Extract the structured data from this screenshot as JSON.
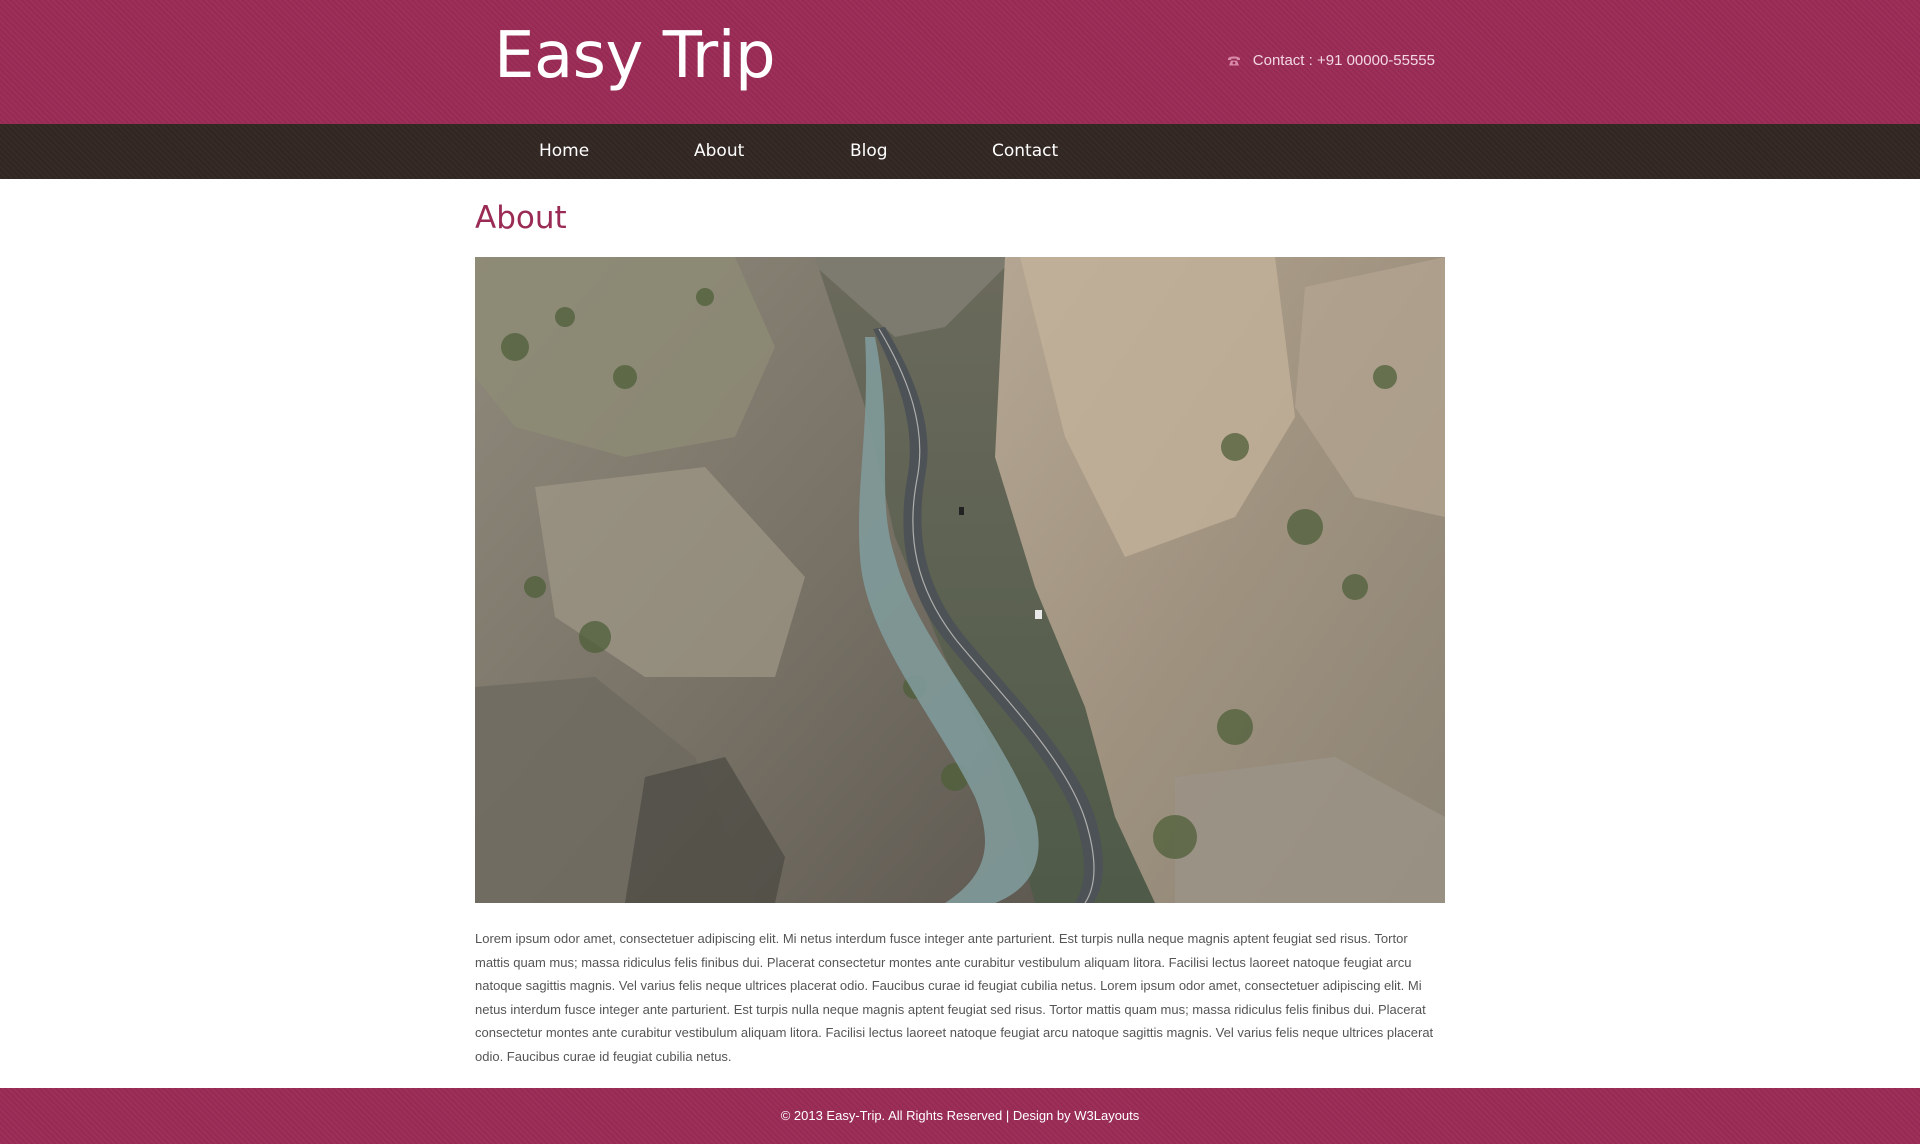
{
  "header": {
    "logo": "Easy Trip",
    "contact_text": "Contact : +91 00000-55555",
    "contact_icon": "phone-icon"
  },
  "nav": {
    "items": [
      {
        "label": "Home"
      },
      {
        "label": "About"
      },
      {
        "label": "Blog"
      },
      {
        "label": "Contact"
      }
    ]
  },
  "main": {
    "title": "About",
    "hero_image": "canyon-road-photo",
    "body": "Lorem ipsum odor amet, consectetuer adipiscing elit. Mi netus interdum fusce integer ante parturient. Est turpis nulla neque magnis aptent feugiat sed risus. Tortor mattis quam mus; massa ridiculus felis finibus dui. Placerat consectetur montes ante curabitur vestibulum aliquam litora. Facilisi lectus laoreet natoque feugiat arcu natoque sagittis magnis. Vel varius felis neque ultrices placerat odio. Faucibus curae id feugiat cubilia netus. Lorem ipsum odor amet, consectetuer adipiscing elit. Mi netus interdum fusce integer ante parturient. Est turpis nulla neque magnis aptent feugiat sed risus. Tortor mattis quam mus; massa ridiculus felis finibus dui. Placerat consectetur montes ante curabitur vestibulum aliquam litora. Facilisi lectus laoreet natoque feugiat arcu natoque sagittis magnis. Vel varius felis neque ultrices placerat odio. Faucibus curae id feugiat cubilia netus."
  },
  "footer": {
    "text": "© 2013 Easy-Trip. All Rights Reserved | Design by W3Layouts"
  },
  "colors": {
    "brand": "#9a2b55",
    "nav_background": "#322723",
    "text": "#555555"
  }
}
